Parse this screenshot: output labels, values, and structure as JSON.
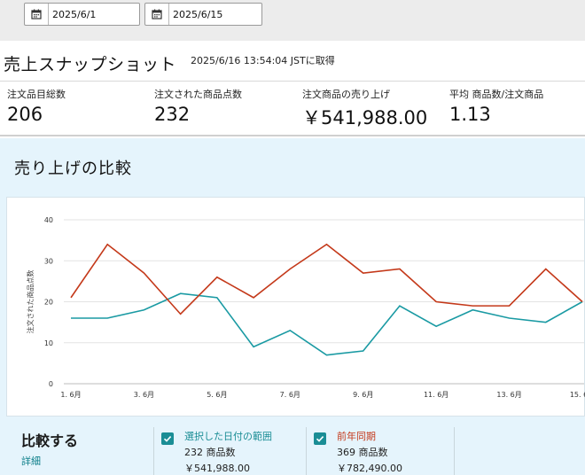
{
  "date_range": {
    "start": "2025/6/1",
    "end": "2025/6/15"
  },
  "header": {
    "title": "売上スナップショット",
    "timestamp": "2025/6/16 13:54:04 JSTに取得"
  },
  "metrics": [
    {
      "label": "注文品目総数",
      "value": "206"
    },
    {
      "label": "注文された商品点数",
      "value": "232"
    },
    {
      "label": "注文商品の売り上げ",
      "value": "￥541,988.00"
    },
    {
      "label": "平均 商品数/注文商品",
      "value": "1.13"
    }
  ],
  "compare": {
    "title": "売り上げの比較",
    "section_title": "比較する",
    "detail_link": "詳細",
    "legend": [
      {
        "name": "選択した日付の範囲",
        "count": "232 商品数",
        "amount": "￥541,988.00",
        "color": "#1a9aa3",
        "checked": true
      },
      {
        "name": "前年同期",
        "count": "369 商品数",
        "amount": "￥782,490.00",
        "color": "#c4391a",
        "checked": true
      }
    ]
  },
  "chart_data": {
    "type": "line",
    "ylabel": "注文された商品点数",
    "ylim": [
      0,
      40
    ],
    "yticks": [
      0,
      10,
      20,
      30,
      40
    ],
    "x": [
      1,
      2,
      3,
      4,
      5,
      6,
      7,
      8,
      9,
      10,
      11,
      12,
      13,
      14,
      15
    ],
    "xtick_labels": [
      {
        "x": 1,
        "label": "1. 6月"
      },
      {
        "x": 3,
        "label": "3. 6月"
      },
      {
        "x": 5,
        "label": "5. 6月"
      },
      {
        "x": 7,
        "label": "7. 6月"
      },
      {
        "x": 9,
        "label": "9. 6月"
      },
      {
        "x": 11,
        "label": "11. 6月"
      },
      {
        "x": 13,
        "label": "13. 6月"
      },
      {
        "x": 15,
        "label": "15. 6月"
      }
    ],
    "grid": true,
    "series": [
      {
        "name": "選択した日付の範囲",
        "color": "#1a9aa3",
        "values": [
          16,
          16,
          18,
          22,
          21,
          9,
          13,
          7,
          8,
          19,
          14,
          18,
          16,
          15,
          20
        ]
      },
      {
        "name": "前年同期",
        "color": "#c4391a",
        "values": [
          21,
          34,
          27,
          17,
          26,
          21,
          28,
          34,
          27,
          28,
          20,
          19,
          19,
          28,
          20
        ]
      }
    ]
  }
}
